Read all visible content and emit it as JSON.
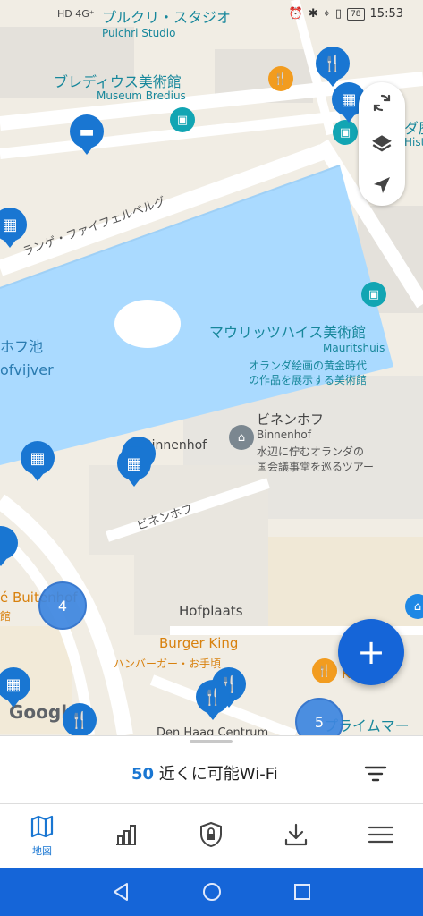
{
  "status_bar": {
    "left_icons": "HD 4G⁺",
    "time": "15:53",
    "battery": "78"
  },
  "map": {
    "labels": {
      "pulchri_ja": "プルクリ・スタジオ",
      "pulchri_en": "Pulchri Studio",
      "bredius_ja": "ブレディウス美術館",
      "bredius_en": "Museum Bredius",
      "rightedge_ja": "ダ歴",
      "rightedge_en": "Hist",
      "lange_vijverberg": "ランゲ・ファイフェルベルグ",
      "hofvijver_ja": "ホフ池",
      "hofvijver_en": "ofvijver",
      "mauritshuis_ja": "マウリッツハイス美術館",
      "mauritshuis_en": "Mauritshuis",
      "mauritshuis_desc1": "オランダ絵画の黄金時代",
      "mauritshuis_desc2": "の作品を展示する美術館",
      "binnenhof_ja": "ビネンホフ",
      "binnenhof_en": "Binnenhof",
      "binnenhof_desc1": "水辺に佇むオランダの",
      "binnenhof_desc2": "国会議事堂を巡るツアー",
      "binnenhof_label": "Binnenhof",
      "binnenhof_road": "ビネンホフ",
      "cafe_buitenhof": "é Buitenhof",
      "cafe_sub": "館",
      "hofplaats": "Hofplaats",
      "burger_king": "Burger King",
      "burger_king_sub": "ハンバーガー・お手頃",
      "kfc_partial": "K",
      "primark_partial": "プライムマー",
      "den_haag_centrum": "Den Haag Centrum",
      "google": "Google"
    },
    "clusters": {
      "left": "4",
      "right": "5"
    }
  },
  "controls": {
    "refresh_icon": "refresh-icon",
    "layers_icon": "layers-icon",
    "locate_icon": "navigation-arrow-icon"
  },
  "fab": {
    "label": "+"
  },
  "bottom_sheet": {
    "count": "50",
    "title": "近くに可能Wi-Fi"
  },
  "tabs": [
    {
      "label": "地図",
      "icon": "map-icon",
      "active": true
    },
    {
      "label": "",
      "icon": "bar-chart-icon"
    },
    {
      "label": "",
      "icon": "shield-lock-icon"
    },
    {
      "label": "",
      "icon": "download-icon"
    },
    {
      "label": "",
      "icon": "menu-icon"
    }
  ],
  "colors": {
    "accent": "#1976d2",
    "water": "#aadaff",
    "navbar": "#1565d8",
    "museum": "#17879b",
    "food": "#d8810e"
  }
}
